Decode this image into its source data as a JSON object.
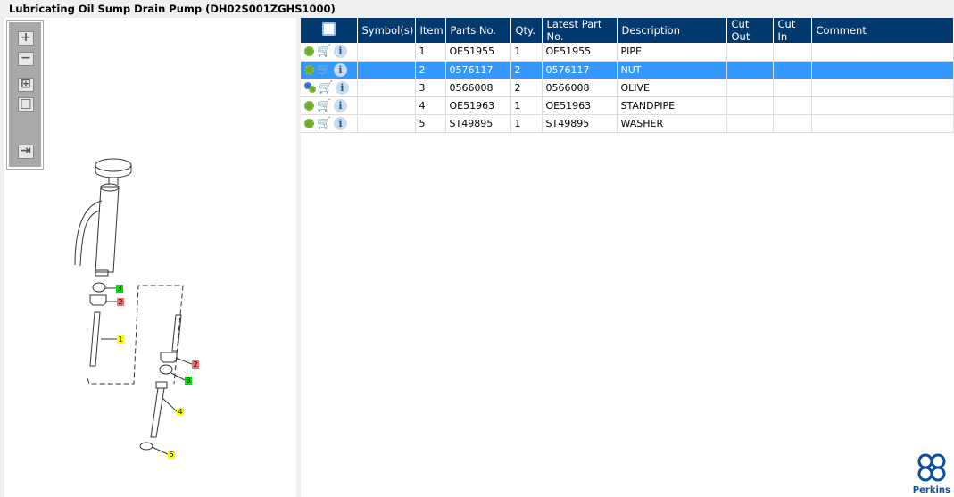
{
  "title": "Lubricating Oil Sump Drain Pump (DH02S001ZGHS1000)",
  "toolbar": {
    "zoom_in": "+",
    "zoom_out": "−",
    "fit": "⊞",
    "actual": "□",
    "export": "⇥"
  },
  "callouts": [
    {
      "label": "3",
      "color": "#00e000"
    },
    {
      "label": "2",
      "color": "#f07070"
    },
    {
      "label": "1",
      "color": "#ffff00"
    },
    {
      "label": "2",
      "color": "#f07070"
    },
    {
      "label": "3",
      "color": "#00e000"
    },
    {
      "label": "4",
      "color": "#ffff00"
    },
    {
      "label": "5",
      "color": "#ffff00"
    }
  ],
  "table": {
    "columns": [
      "Symbol(s)",
      "Item",
      "Parts No.",
      "Qty.",
      "Latest Part No.",
      "Description",
      "Cut Out",
      "Cut In",
      "Comment"
    ],
    "rows": [
      {
        "item": "1",
        "part": "OE51955",
        "qty": "1",
        "latest": "OE51955",
        "desc": "PIPE",
        "gear": "single"
      },
      {
        "item": "2",
        "part": "0576117",
        "qty": "2",
        "latest": "0576117",
        "desc": "NUT",
        "gear": "single",
        "selected": true
      },
      {
        "item": "3",
        "part": "0566008",
        "qty": "2",
        "latest": "0566008",
        "desc": "OLIVE",
        "gear": "multi"
      },
      {
        "item": "4",
        "part": "OE51963",
        "qty": "1",
        "latest": "OE51963",
        "desc": "STANDPIPE",
        "gear": "single"
      },
      {
        "item": "5",
        "part": "ST49895",
        "qty": "1",
        "latest": "ST49895",
        "desc": "WASHER",
        "gear": "single"
      }
    ]
  },
  "colors": {
    "header": "#023a70",
    "selected": "#3399ff"
  },
  "logo": {
    "text": "Perkins"
  }
}
